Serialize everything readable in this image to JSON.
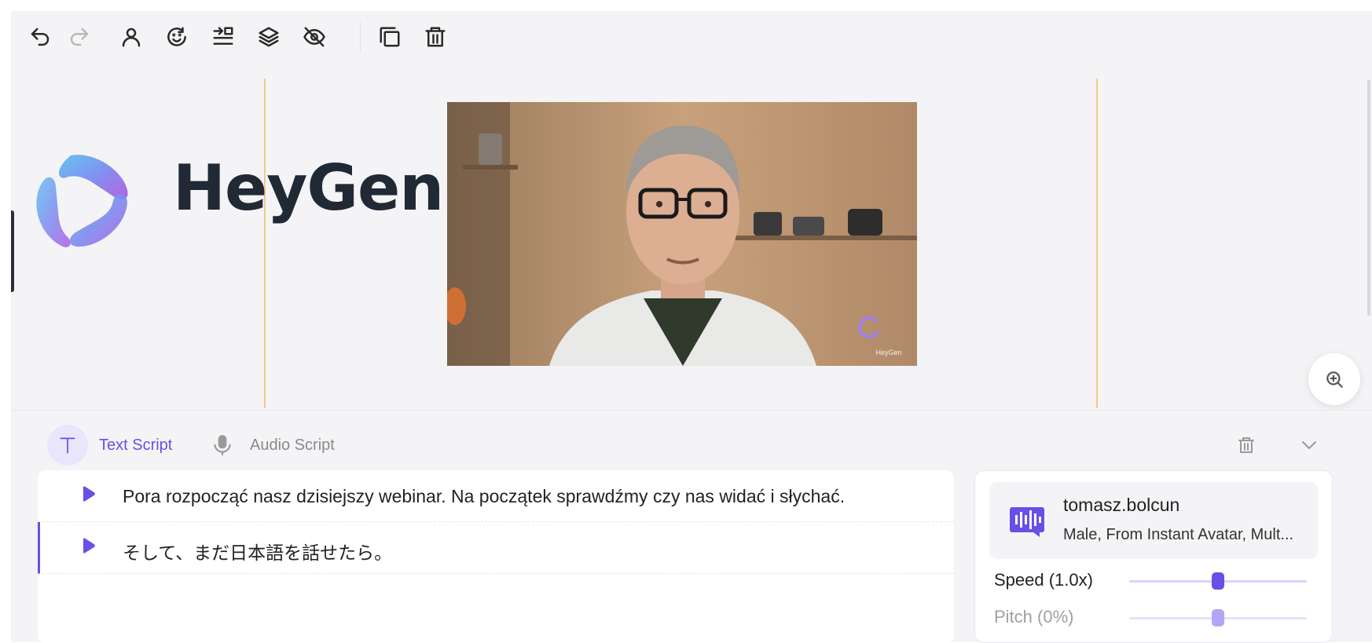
{
  "toolbar": {
    "buttons": [
      {
        "name": "undo",
        "icon": "undo-icon",
        "enabled": true
      },
      {
        "name": "redo",
        "icon": "redo-icon",
        "enabled": false
      },
      {
        "name": "avatar",
        "icon": "person-icon",
        "enabled": true
      },
      {
        "name": "face",
        "icon": "face-icon",
        "enabled": true
      },
      {
        "name": "align",
        "icon": "align-icon",
        "enabled": true
      },
      {
        "name": "layers",
        "icon": "layers-icon",
        "enabled": true
      },
      {
        "name": "hide",
        "icon": "eye-off-icon",
        "enabled": true
      },
      {
        "name": "duplicate",
        "icon": "copy-icon",
        "enabled": true
      },
      {
        "name": "delete",
        "icon": "trash-icon",
        "enabled": true
      }
    ]
  },
  "canvas": {
    "logo_text": "HeyGen",
    "watermark_text": "HeyGen"
  },
  "script_panel": {
    "tabs": [
      {
        "label": "Text Script",
        "icon": "text-icon",
        "active": true
      },
      {
        "label": "Audio Script",
        "icon": "microphone-icon",
        "active": false
      }
    ],
    "lines": [
      {
        "text": "Pora rozpocząć nasz dzisiejszy webinar. Na początek sprawdźmy czy nas widać i słychać.",
        "active": false
      },
      {
        "text": "そして、まだ日本語を話せたら。",
        "active": true
      }
    ]
  },
  "voice": {
    "name": "tomasz.bolcun",
    "description": "Male, From Instant Avatar, Mult...",
    "speed": {
      "label": "Speed (1.0x)",
      "value": 0.5,
      "enabled": true
    },
    "pitch": {
      "label": "Pitch (0%)",
      "value": 0.5,
      "enabled": false
    }
  },
  "colors": {
    "accent": "#6a4fe6",
    "guide": "#f3c98a",
    "background": "#f4f4f7"
  }
}
